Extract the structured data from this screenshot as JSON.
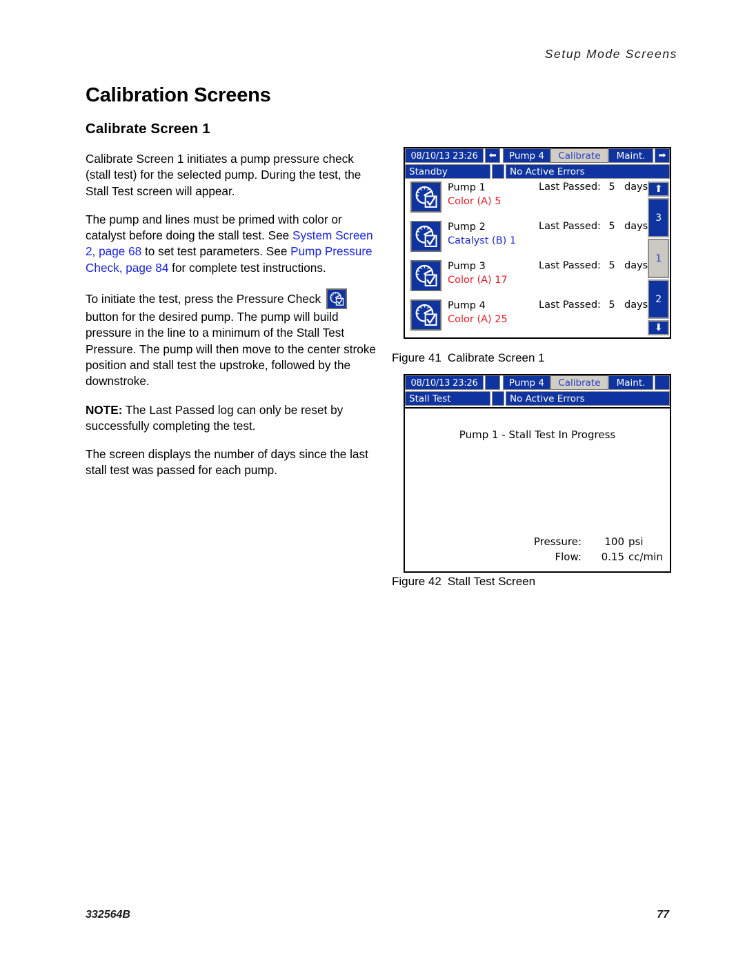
{
  "running_head": "Setup Mode Screens",
  "headings": {
    "h1": "Calibration Screens",
    "h2": "Calibrate Screen 1"
  },
  "paragraphs": {
    "p1": "Calibrate Screen 1 initiates a pump pressure check (stall test) for the selected pump. During the test, the Stall Test screen will appear.",
    "p2_a": "The pump and lines must be primed with color or catalyst before doing the stall test.  See ",
    "p2_link1": "System Screen 2, page 68",
    "p2_b": " to set test parameters. See ",
    "p2_link2": "Pump Pressure Check, page 84",
    "p2_c": " for complete test instructions.",
    "p3_a": "To initiate the test, press the Pressure Check ",
    "p3_b": "button for the desired pump. The pump will build pressure in the line to a minimum of the Stall Test Pressure.  The pump will then move to the center stroke position and stall test the upstroke, followed by the downstroke.",
    "p4_lead": "NOTE:",
    "p4_rest": " The Last Passed log can only be reset by successfully completing the test.",
    "p5": "The screen displays the number of days since the last stall test was passed for each pump."
  },
  "figure41": {
    "caption_number": "Figure 41",
    "caption_text": "Calibrate Screen 1",
    "status_bar": {
      "datetime": "08/10/13 23:26",
      "left_arrow_icon": "left-arrow-icon",
      "pump_selector": "Pump 4",
      "tab_active": "Calibrate",
      "tab_maint": "Maint.",
      "right_arrow_icon": "right-arrow-icon",
      "mode": "Standby",
      "errors": "No Active Errors"
    },
    "pumps": [
      {
        "name": "Pump 1",
        "fluid": "Color (A) 5",
        "fluid_type": "color",
        "passed_label": "Last Passed:",
        "days": "5",
        "unit": "days",
        "icon": "pressure-check-icon"
      },
      {
        "name": "Pump 2",
        "fluid": "Catalyst (B) 1",
        "fluid_type": "catalyst",
        "passed_label": "Last Passed:",
        "days": "5",
        "unit": "days",
        "icon": "pressure-check-icon"
      },
      {
        "name": "Pump 3",
        "fluid": "Color (A) 17",
        "fluid_type": "color",
        "passed_label": "Last Passed:",
        "days": "5",
        "unit": "days",
        "icon": "pressure-check-icon"
      },
      {
        "name": "Pump 4",
        "fluid": "Color (A) 25",
        "fluid_type": "color",
        "passed_label": "Last Passed:",
        "days": "5",
        "unit": "days",
        "icon": "pressure-check-icon"
      }
    ],
    "side_strip": {
      "up_icon": "up-arrow-icon",
      "pages": [
        {
          "label": "3",
          "selected": false
        },
        {
          "label": "1",
          "selected": true
        },
        {
          "label": "2",
          "selected": false
        }
      ],
      "down_icon": "down-arrow-icon"
    }
  },
  "figure42": {
    "caption_number": "Figure 42",
    "caption_text": "Stall Test Screen",
    "status_bar": {
      "datetime": "08/10/13 23:26",
      "pump_selector": "Pump 4",
      "tab_active": "Calibrate",
      "tab_maint": "Maint.",
      "mode": "Stall Test",
      "errors": "No Active Errors"
    },
    "title": "Pump 1 - Stall Test In Progress",
    "readouts": [
      {
        "label": "Pressure:",
        "value": "100",
        "unit": "psi"
      },
      {
        "label": "Flow:",
        "value": "0.15",
        "unit": "cc/min"
      }
    ]
  },
  "footer": {
    "doc_number": "332564B",
    "page_number": "77"
  },
  "colors": {
    "ui_blue": "#10349f",
    "link_blue": "#1b24e8",
    "fluid_red": "#ec1c24",
    "fluid_blue": "#1b28d8",
    "tab_face": "#d2cec6"
  }
}
